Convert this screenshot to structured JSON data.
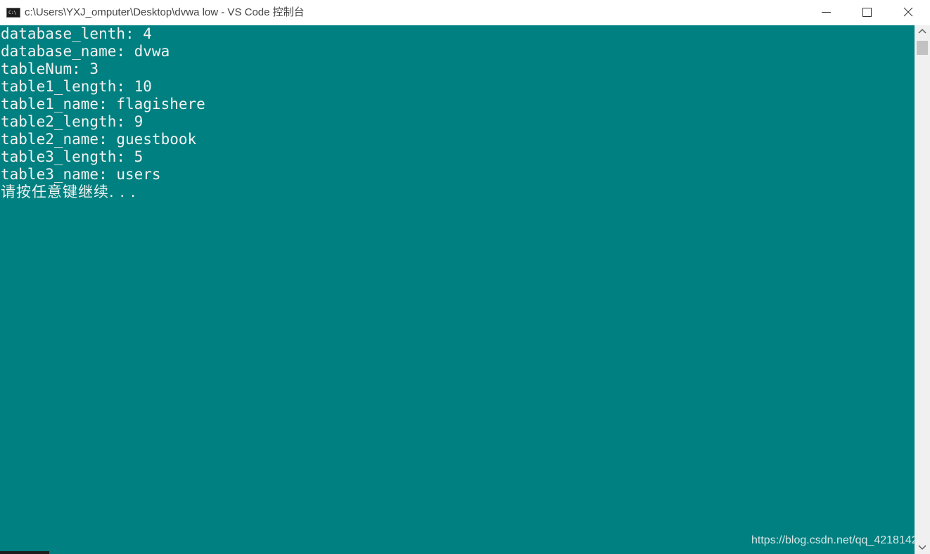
{
  "window": {
    "title": "c:\\Users\\YXJ_omputer\\Desktop\\dvwa low - VS Code 控制台",
    "icon": "console-app-icon",
    "icon_text": "C:\\",
    "controls": {
      "minimize": "minimize-icon",
      "maximize": "maximize-icon",
      "close": "close-icon"
    }
  },
  "console": {
    "background": "#008080",
    "foreground": "#f2f2f2",
    "lines": [
      "database_lenth: 4",
      "database_name: dvwa",
      "tableNum: 3",
      "table1_length: 10",
      "table1_name: flagishere",
      "table2_length: 9",
      "table2_name: guestbook",
      "table3_length: 5",
      "table3_name: users",
      "请按任意键继续. . ."
    ]
  },
  "watermark": "https://blog.csdn.net/qq_4218142",
  "scrollbar": {
    "up_icon": "chevron-up-icon",
    "down_icon": "chevron-down-icon"
  }
}
